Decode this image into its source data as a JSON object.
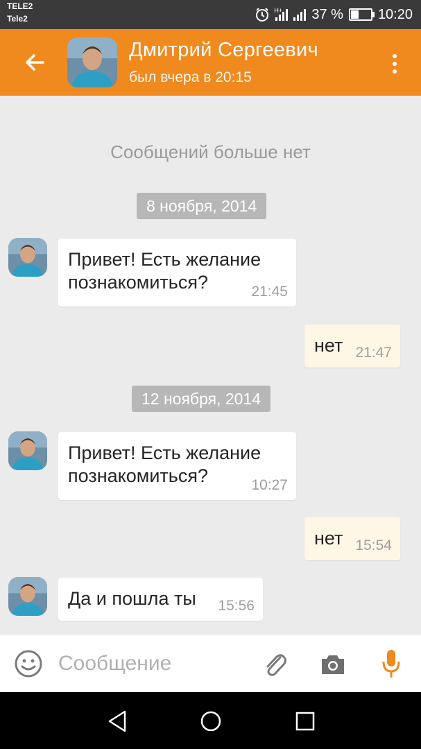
{
  "status_bar": {
    "carrier_top": "TELE2",
    "carrier_bottom": "Tele2",
    "network": "H+",
    "battery_text": "37 %",
    "battery_level": 0.37,
    "time": "10:20"
  },
  "header": {
    "contact_name": "Дмитрий Сергеевич",
    "last_seen": "был вчера в 20:15",
    "accent_color": "#f08a1e"
  },
  "chat": {
    "no_more_messages": "Сообщений больше нет",
    "date_1": "8 ноября, 2014",
    "date_2": "12 ноября, 2014",
    "messages": [
      {
        "direction": "in",
        "text_line1": "Привет! Есть желание",
        "text_line2": "познакомиться?",
        "time": "21:45"
      },
      {
        "direction": "out",
        "text": "нет",
        "time": "21:47"
      },
      {
        "direction": "in",
        "text_line1": "Привет! Есть желание",
        "text_line2": "познакомиться?",
        "time": "10:27"
      },
      {
        "direction": "out",
        "text": "нет",
        "time": "15:54"
      },
      {
        "direction": "in",
        "text": "Да и пошла ты",
        "time": "15:56"
      }
    ]
  },
  "input": {
    "placeholder": "Сообщение",
    "icons": [
      "smiley-icon",
      "paperclip-icon",
      "camera-icon",
      "microphone-icon"
    ]
  },
  "nav": {
    "icons": [
      "back-triangle-icon",
      "home-circle-icon",
      "recents-square-icon"
    ]
  }
}
